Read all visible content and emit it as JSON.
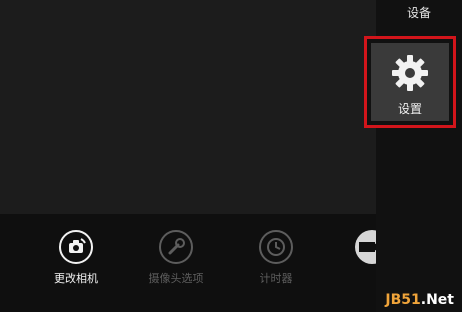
{
  "charm": {
    "title": "设备",
    "settings_label": "设置"
  },
  "toolbar": {
    "tools": [
      {
        "label": "更改相机",
        "icon": "camera-switch-icon",
        "enabled": true
      },
      {
        "label": "摄像头选项",
        "icon": "wrench-icon",
        "enabled": false
      },
      {
        "label": "计时器",
        "icon": "clock-icon",
        "enabled": false
      }
    ],
    "partial_tool_icon": "video-icon"
  },
  "watermark": {
    "prefix": "JB51",
    "suffix": ".Net"
  },
  "colors": {
    "highlight_border": "#d2151b",
    "active_text": "#f2f2f2",
    "disabled_text": "#5d5d5d",
    "watermark_orange": "#f0a43a"
  }
}
